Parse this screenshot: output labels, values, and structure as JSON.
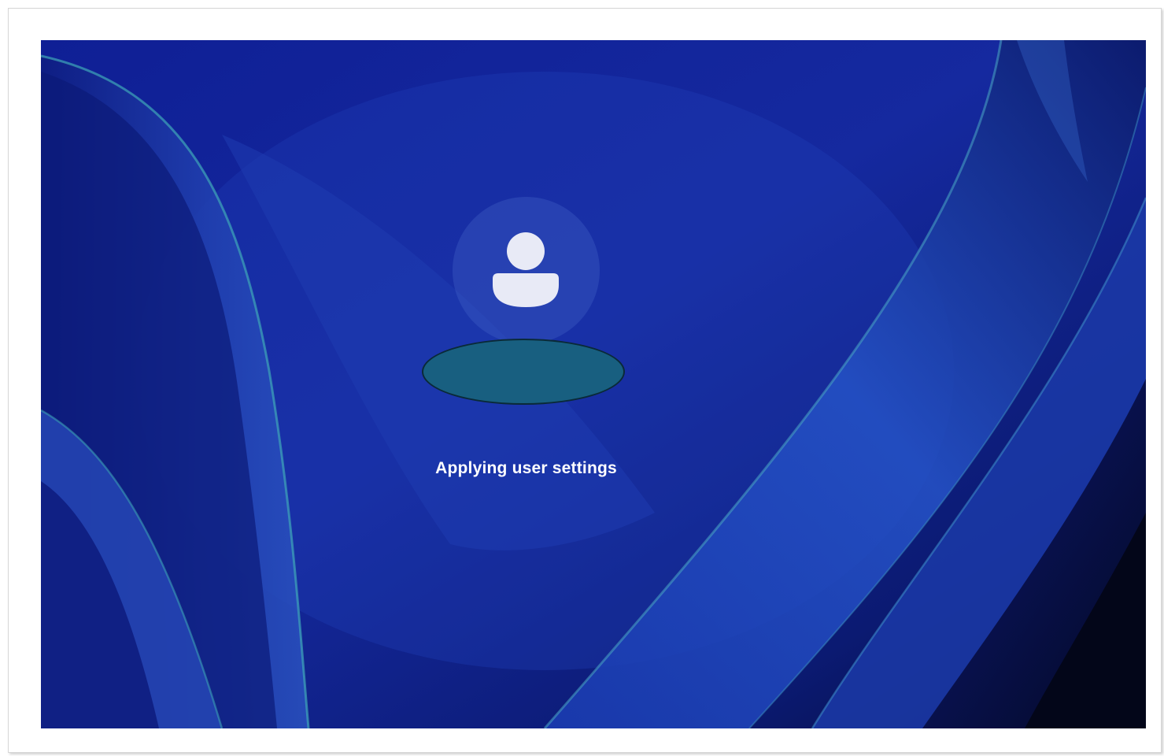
{
  "login_screen": {
    "status_text": "Applying user settings",
    "avatar_icon": "user-icon",
    "user_name_redacted": true
  },
  "colors": {
    "wallpaper_base": "#10239a",
    "text": "#ffffff",
    "redaction_fill": "#185f80"
  }
}
